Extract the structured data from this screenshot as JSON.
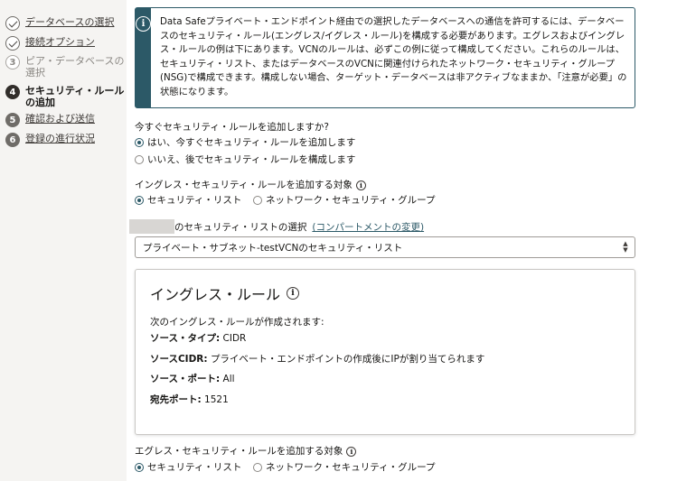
{
  "steps": [
    {
      "num": "1",
      "label": "データベースの選択",
      "state": "done"
    },
    {
      "num": "2",
      "label": "接続オプション",
      "state": "done"
    },
    {
      "num": "3",
      "label": "ピア・データベースの選択",
      "state": "pending"
    },
    {
      "num": "4",
      "label": "セキュリティ・ルールの追加",
      "state": "active"
    },
    {
      "num": "5",
      "label": "確認および送信",
      "state": "next"
    },
    {
      "num": "6",
      "label": "登録の進行状況",
      "state": "next"
    }
  ],
  "info": {
    "icon": "info-icon",
    "text": "Data Safeプライベート・エンドポイント経由での選択したデータベースへの通信を許可するには、データベースのセキュリティ・ルール(エングレス/イグレス・ルール)を構成する必要があります。エグレスおよびイングレス・ルールの例は下にあります。VCNのルールは、必ずこの例に従って構成してください。これらのルールは、セキュリティ・リスト、またはデータベースのVCNに関連付けられたネットワーク・セキュリティ・グループ(NSG)で構成できます。構成しない場合、ターゲット・データベースは非アクティブなままか、「注意が必要」の状態になります。"
  },
  "add_now": {
    "question": "今すぐセキュリティ・ルールを追加しますか?",
    "options": [
      {
        "label": "はい、今すぐセキュリティ・ルールを追加します",
        "selected": true
      },
      {
        "label": "いいえ、後でセキュリティ・ルールを構成します",
        "selected": false
      }
    ]
  },
  "ingress_target": {
    "question": "イングレス・セキュリティ・ルールを追加する対象",
    "options": [
      {
        "label": "セキュリティ・リスト",
        "selected": true
      },
      {
        "label": "ネットワーク・セキュリティ・グループ",
        "selected": false
      }
    ]
  },
  "security_list": {
    "label": "のセキュリティ・リストの選択",
    "change_link": "(コンパートメントの変更)",
    "selected": "プライベート・サブネット-testVCNのセキュリティ・リスト"
  },
  "ingress_rule": {
    "title": "イングレス・ルール",
    "intro": "次のイングレス・ルールが作成されます:",
    "source_type_label": "ソース・タイプ:",
    "source_type_value": "CIDR",
    "source_cidr_label": "ソースCIDR:",
    "source_cidr_value": "プライベート・エンドポイントの作成後にIPが割り当てられます",
    "source_port_label": "ソース・ポート:",
    "source_port_value": "All",
    "dest_port_label": "宛先ポート:",
    "dest_port_value": "1521"
  },
  "egress_target": {
    "question": "エグレス・セキュリティ・ルールを追加する対象",
    "options": [
      {
        "label": "セキュリティ・リスト",
        "selected": true
      },
      {
        "label": "ネットワーク・セキュリティ・グループ",
        "selected": false
      }
    ]
  }
}
